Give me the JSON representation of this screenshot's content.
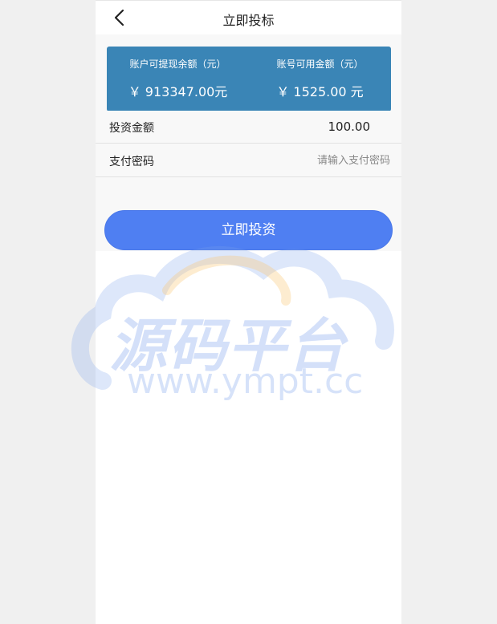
{
  "header": {
    "title": "立即投标"
  },
  "balance": {
    "withdrawable_label": "账户可提现余额（元）",
    "withdrawable_value": "￥ 913347.00元",
    "available_label": "账号可用金额（元）",
    "available_value": "￥ 1525.00 元"
  },
  "form": {
    "amount_label": "投资金额",
    "amount_value": "100.00",
    "password_label": "支付密码",
    "password_placeholder": "请输入支付密码",
    "password_value": ""
  },
  "actions": {
    "invest_label": "立即投资"
  },
  "watermark": {
    "title": "源码平台",
    "url": "www.ympt.cc"
  },
  "icons": {
    "back": "chevron-left-icon"
  },
  "colors": {
    "card": "#3a85b6",
    "button": "#4f7ff2",
    "watermark": "#78a0eb"
  }
}
